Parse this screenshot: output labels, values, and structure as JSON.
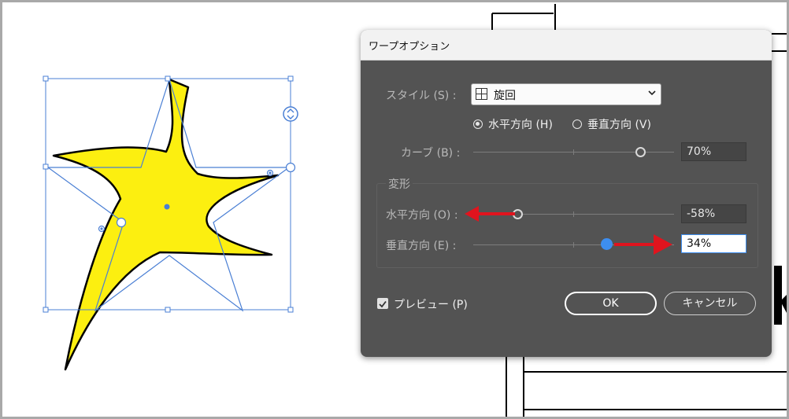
{
  "dialog": {
    "title": "ワープオプション",
    "style_label": "スタイル (S) :",
    "style_value": "旋回",
    "horizontal_radio": "水平方向 (H)",
    "vertical_radio": "垂直方向 (V)",
    "orientation_selected": "horizontal",
    "bend_label": "カーブ (B) :",
    "bend_value": "70%",
    "bend_level": 0.7,
    "distortion_group": "変形",
    "horizontal_label": "水平方向 (O) :",
    "horizontal_value": "-58%",
    "horizontal_level": -0.58,
    "vertical_label": "垂直方向 (E) :",
    "vertical_value": "34%",
    "vertical_level": 0.34,
    "preview_label": "プレビュー (P)",
    "preview_checked": true,
    "ok_label": "OK",
    "cancel_label": "キャンセル"
  },
  "colors": {
    "dialog_bg": "#535353",
    "shape_fill": "#fcef10",
    "selection": "#4a7fd4",
    "arrow": "#e0141e",
    "accent": "#3d8ef0"
  },
  "icons": {
    "style": "warp-grid-icon",
    "dropdown": "chevron-down-icon",
    "rotate": "rotate-handle-icon"
  }
}
